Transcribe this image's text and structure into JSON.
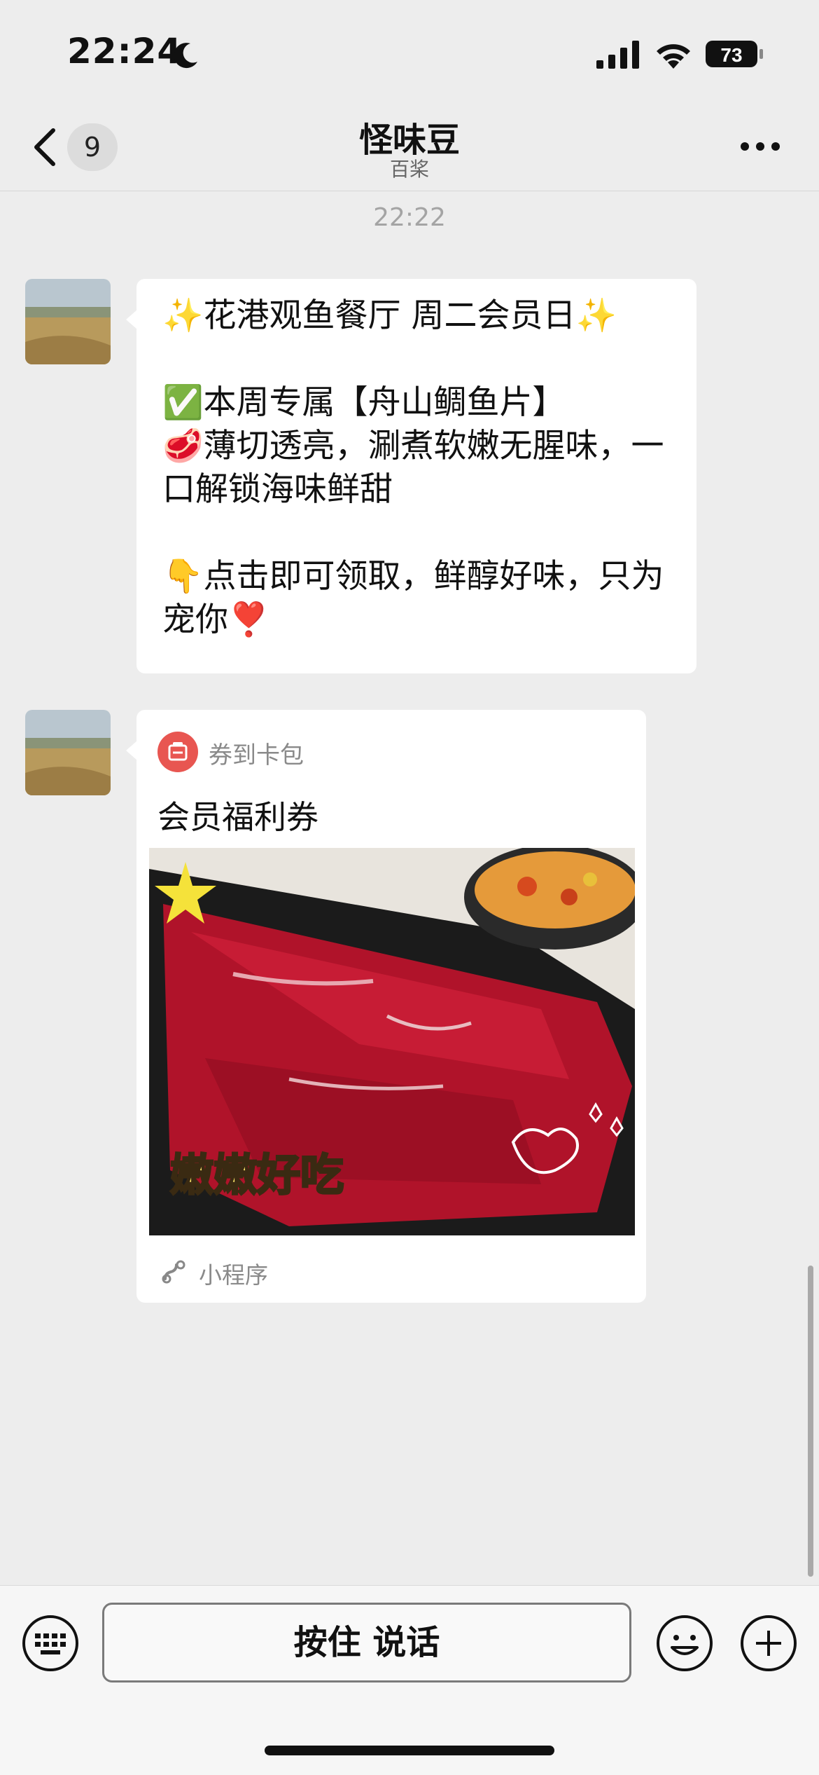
{
  "status_bar": {
    "time": "22:24",
    "battery": "73"
  },
  "header": {
    "unread_count": "9",
    "title": "怪味豆",
    "subtitle": "百桨"
  },
  "timestamp": "22:22",
  "message": {
    "text": "✨花港观鱼餐厅 周二会员日✨\n\n✅本周专属【舟山鲷鱼片】\n🥩薄切透亮，涮煮软嫩无腥味，一口解锁海味鲜甜\n\n👇点击即可领取，鲜醇好味，只为宠你❣️"
  },
  "card": {
    "source_label": "券到卡包",
    "title": "会员福利券",
    "image_caption": "嫩嫩好吃",
    "footer_label": "小程序"
  },
  "input_bar": {
    "voice_label": "按住 说话"
  },
  "colors": {
    "background": "#ededed",
    "bubble": "#ffffff",
    "card_source_icon": "#e85651"
  }
}
